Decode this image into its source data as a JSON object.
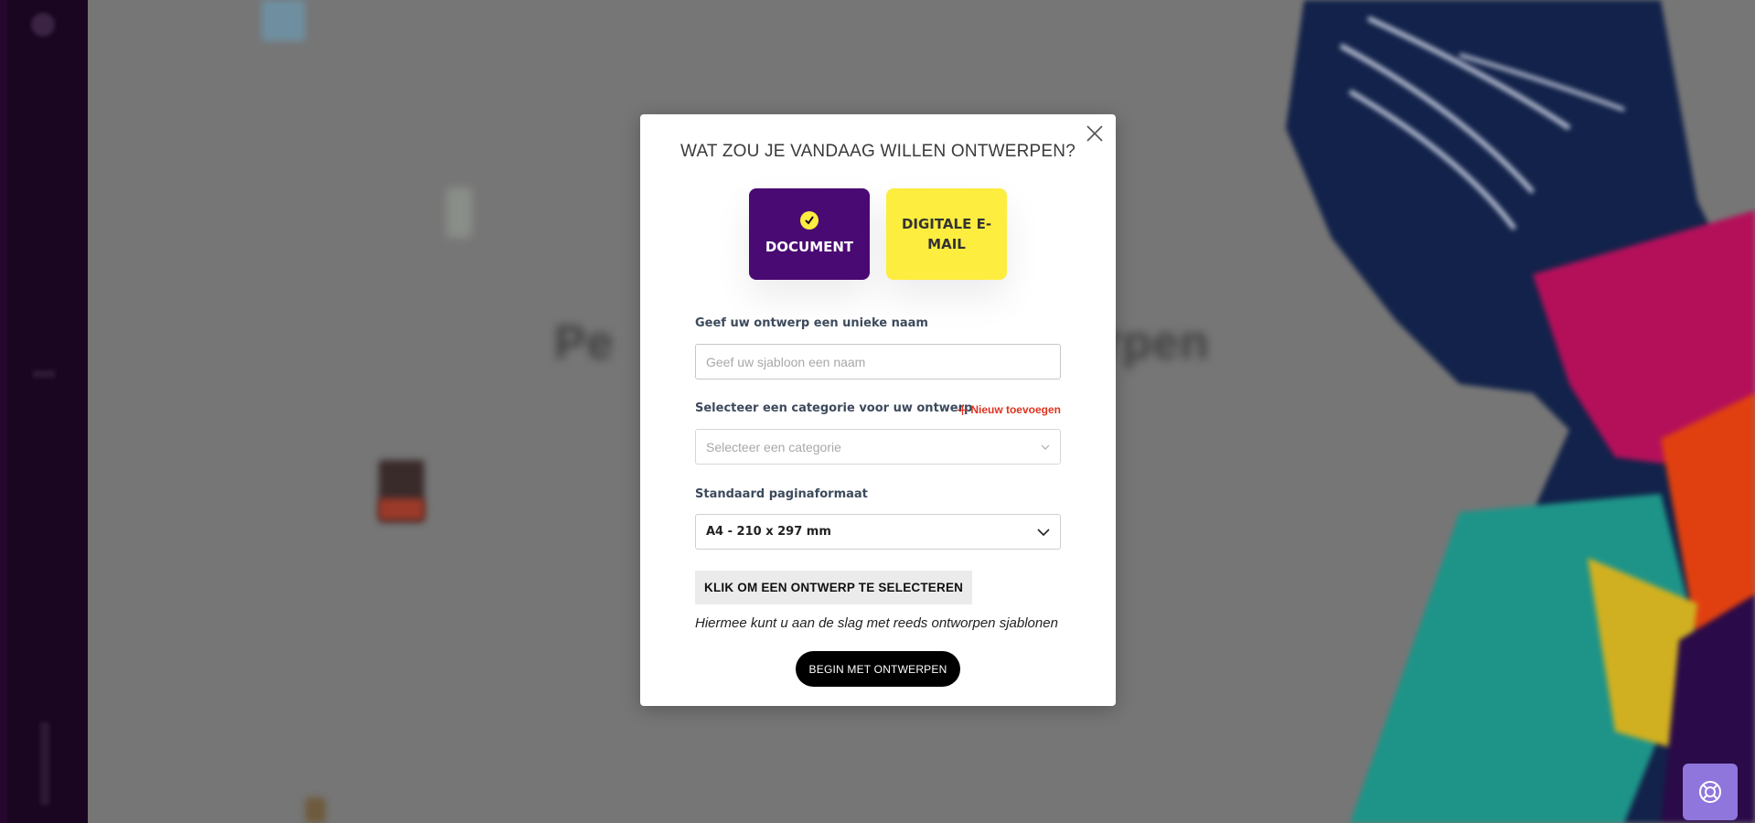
{
  "modal": {
    "title": "WAT ZOU JE VANDAAG WILLEN ONTWERPEN?",
    "close_icon": "close-icon",
    "types": [
      {
        "label": "DOCUMENT",
        "selected": true,
        "color": "#4a0a73"
      },
      {
        "label": "DIGITALE E-MAIL",
        "selected": false,
        "color": "#fced3f"
      }
    ],
    "name_field": {
      "label": "Geef uw ontwerp een unieke naam",
      "placeholder": "Geef uw sjabloon een naam",
      "value": ""
    },
    "category_field": {
      "label": "Selecteer een categorie voor uw ontwerp",
      "add_new_label": "Nieuw toevoegen",
      "placeholder": "Selecteer een categorie"
    },
    "format_field": {
      "label": "Standaard paginaformaat",
      "value": "A4 - 210 x 297 mm"
    },
    "pick_design_label": "KLIK OM EEN ONTWERP TE SELECTEREN",
    "hint": "Hiermee kunt u aan de slag met reeds ontworpen sjablonen",
    "start_label": "BEGIN MET ONTWERPEN"
  },
  "help": {
    "icon": "lifebuoy-icon"
  },
  "colors": {
    "accent_purple": "#4a0a73",
    "accent_yellow": "#fced3f",
    "add_new_red": "#e0321f",
    "help_purple": "#8e76dc"
  }
}
